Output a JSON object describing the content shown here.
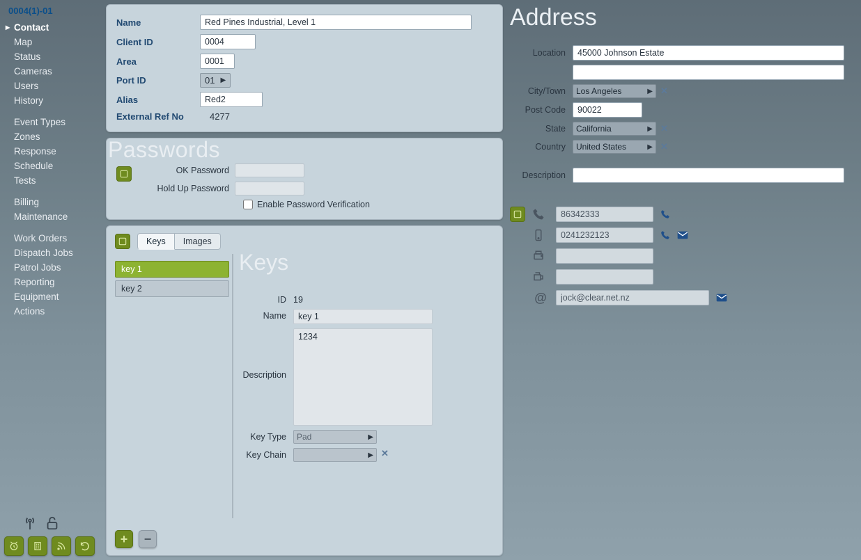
{
  "record_id": "0004(1)-01",
  "sidebar": {
    "groups": [
      [
        "Contact",
        "Map",
        "Status",
        "Cameras",
        "Users",
        "History"
      ],
      [
        "Event Types",
        "Zones",
        "Response",
        "Schedule",
        "Tests"
      ],
      [
        "Billing",
        "Maintenance"
      ],
      [
        "Work Orders",
        "Dispatch Jobs",
        "Patrol Jobs",
        "Reporting",
        "Equipment",
        "Actions"
      ]
    ],
    "active": "Contact"
  },
  "identity": {
    "labels": {
      "name": "Name",
      "client_id": "Client ID",
      "area": "Area",
      "port_id": "Port ID",
      "alias": "Alias",
      "ext_ref": "External Ref No"
    },
    "name": "Red Pines Industrial, Level 1",
    "client_id": "0004",
    "area": "0001",
    "port_id": "01",
    "alias": "Red2",
    "ext_ref": "4277"
  },
  "passwords": {
    "title": "Passwords",
    "labels": {
      "ok": "OK Password",
      "holdup": "Hold Up Password",
      "enable": "Enable Password Verification"
    },
    "ok": "",
    "holdup": "",
    "enable": false
  },
  "keys_panel": {
    "tabs": [
      "Keys",
      "Images"
    ],
    "active_tab": "Keys",
    "list": [
      "key 1",
      "key 2"
    ],
    "selected": "key 1",
    "title": "Keys",
    "detail": {
      "labels": {
        "id": "ID",
        "name": "Name",
        "description": "Description",
        "key_type": "Key Type",
        "key_chain": "Key Chain"
      },
      "id": "19",
      "name": "key 1",
      "description": "1234",
      "key_type": "Pad",
      "key_chain": ""
    }
  },
  "address": {
    "title": "Address",
    "labels": {
      "location": "Location",
      "city": "City/Town",
      "post": "Post Code",
      "state": "State",
      "country": "Country",
      "description": "Description"
    },
    "location1": "45000 Johnson Estate",
    "location2": "",
    "city": "Los Angeles",
    "post": "90022",
    "state": "California",
    "country": "United States",
    "description": ""
  },
  "contacts": {
    "phone": "86342333",
    "mobile": "0241232123",
    "fax": "",
    "pager": "",
    "email": "jock@clear.net.nz"
  }
}
